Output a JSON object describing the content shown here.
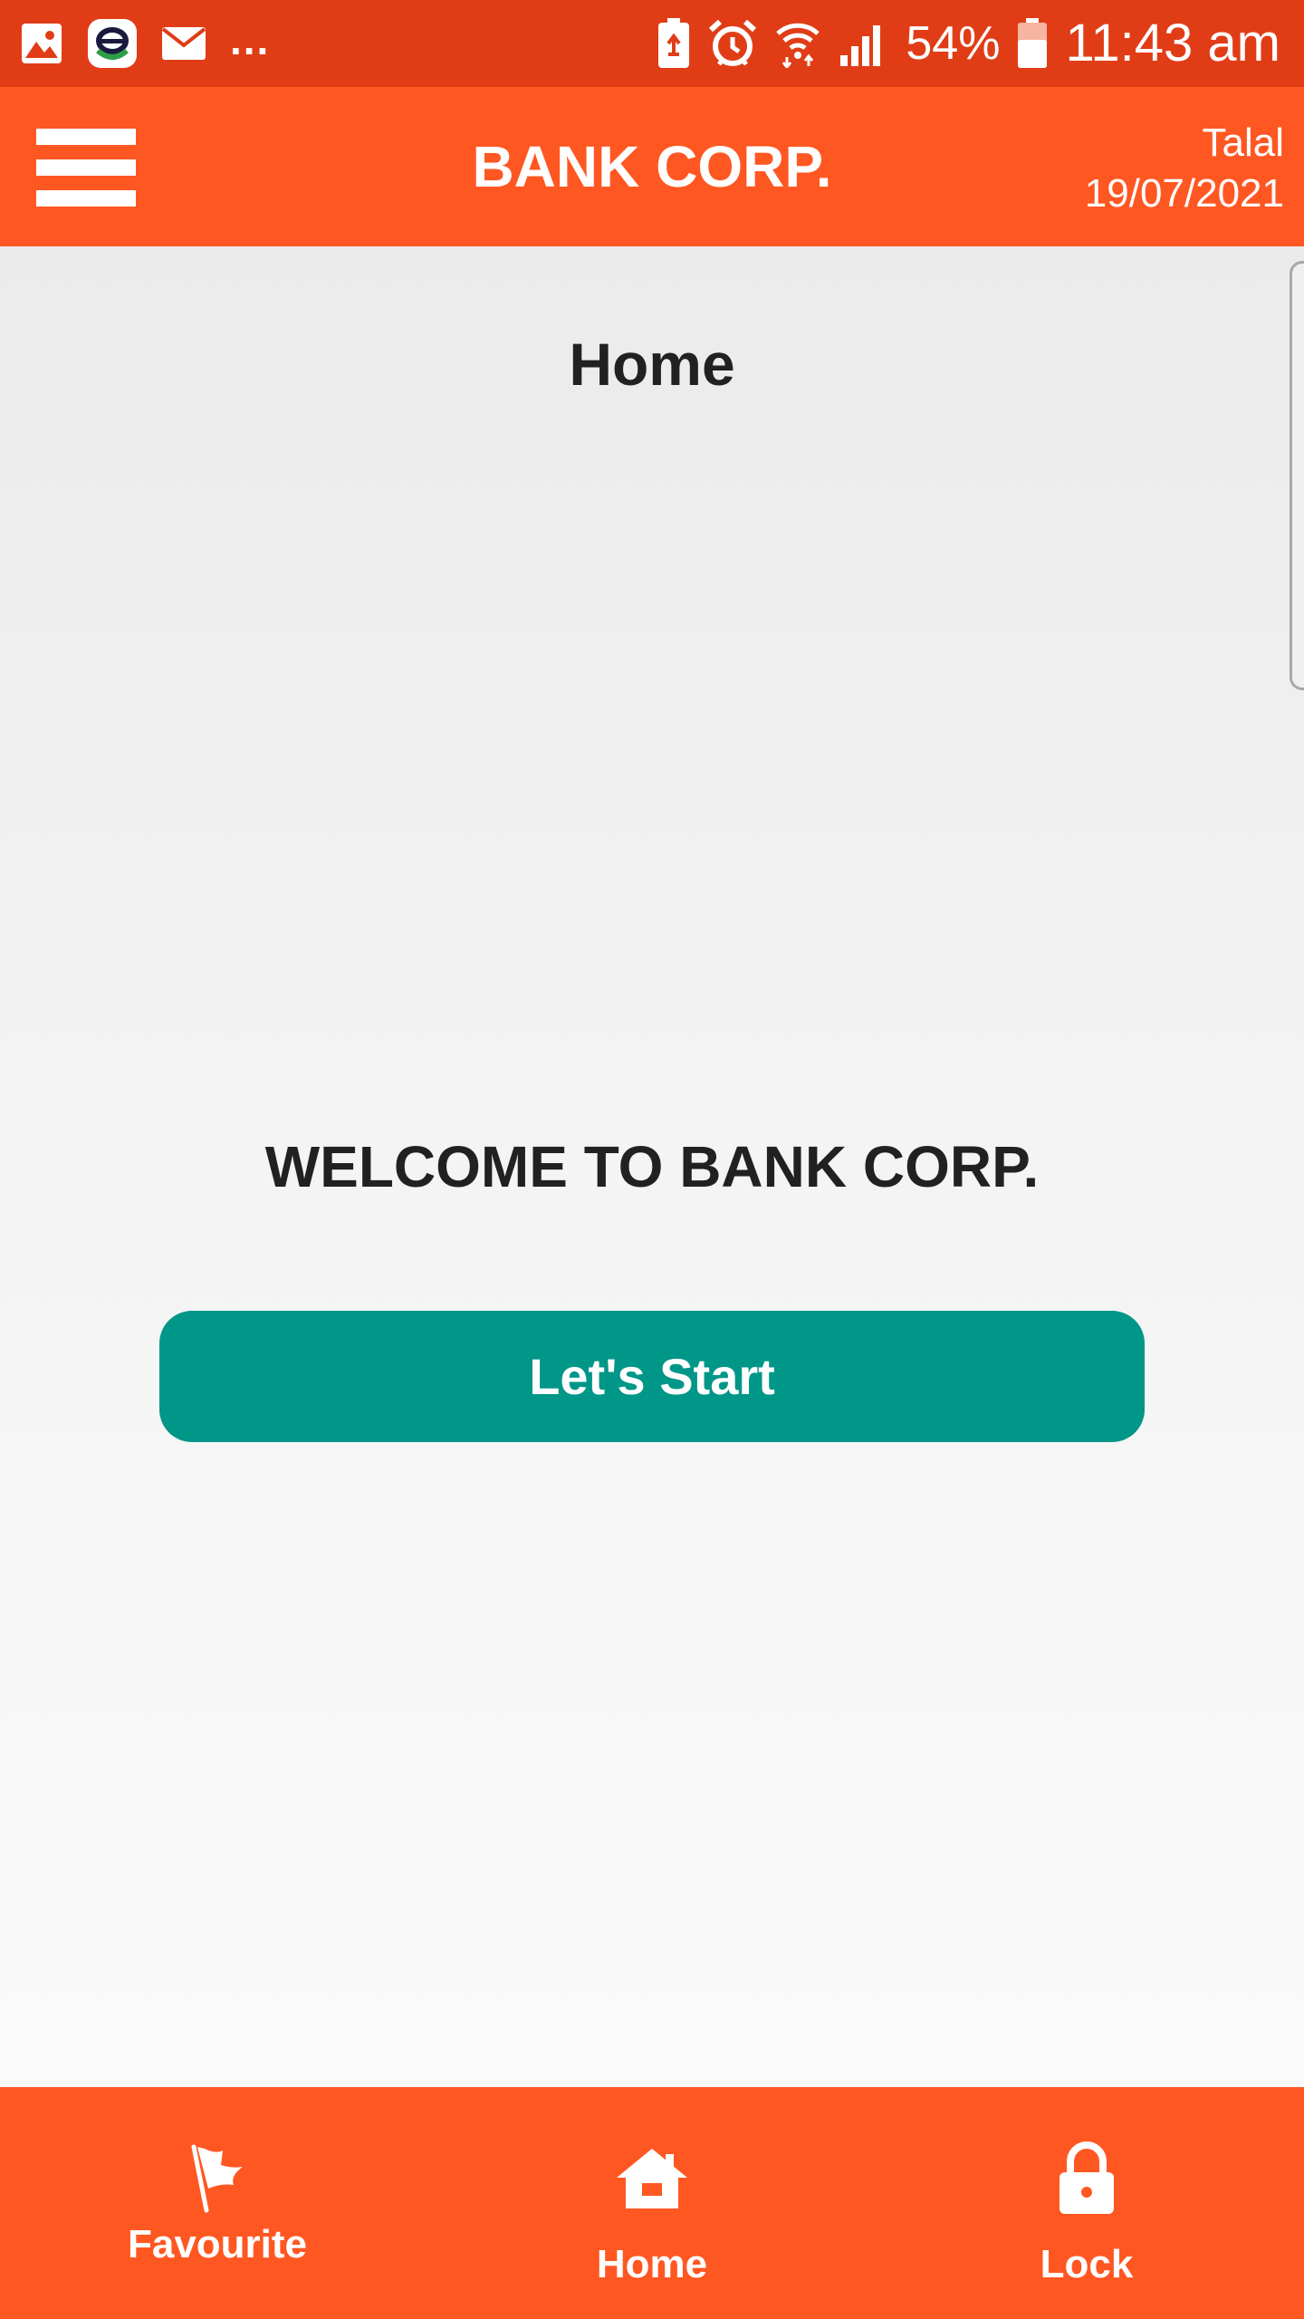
{
  "status_bar": {
    "icons": [
      "gallery-icon",
      "app-notification-icon",
      "email-icon"
    ],
    "overflow": "...",
    "right_icons": [
      "battery-saver-icon",
      "alarm-icon",
      "wifi-icon",
      "signal-icon"
    ],
    "battery_percent": "54%",
    "time": "11:43 am"
  },
  "app_bar": {
    "menu_icon": "hamburger-menu-icon",
    "title": "BANK CORP.",
    "user_name": "Talal",
    "date": "19/07/2021"
  },
  "main": {
    "page_title": "Home",
    "welcome": "WELCOME TO BANK CORP.",
    "start_button_label": "Let's Start"
  },
  "bottom_nav": {
    "items": [
      {
        "label": "Favourite",
        "icon": "flag-icon"
      },
      {
        "label": "Home",
        "icon": "house-icon"
      },
      {
        "label": "Lock",
        "icon": "lock-icon"
      }
    ]
  },
  "colors": {
    "status_bar": "#e03d17",
    "primary": "#ff5722",
    "accent_button": "#009688",
    "text_dark": "#212121"
  }
}
